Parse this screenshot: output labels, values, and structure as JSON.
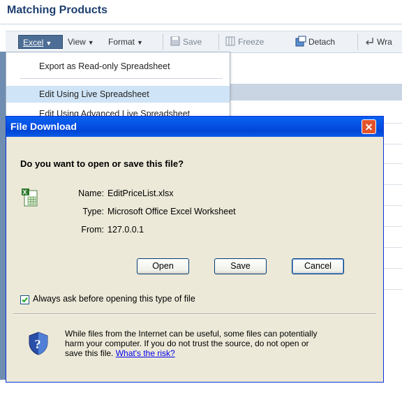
{
  "page": {
    "title": "Matching Products"
  },
  "toolbar": {
    "excel_label": "Excel",
    "view_label": "View",
    "format_label": "Format",
    "save_label": "Save",
    "freeze_label": "Freeze",
    "detach_label": "Detach",
    "wrap_label": "Wra"
  },
  "excel_menu": {
    "items": [
      {
        "label": "Export as Read-only Spreadsheet"
      },
      {
        "label": "Edit Using Live Spreadsheet"
      },
      {
        "label": "Edit Using Advanced Live Spreadsheet"
      }
    ]
  },
  "dialog": {
    "title": "File Download",
    "question": "Do you want to open or save this file?",
    "fields": [
      {
        "label": "Name:",
        "value": "EditPriceList.xlsx"
      },
      {
        "label": "Type:",
        "value": "Microsoft Office Excel Worksheet"
      },
      {
        "label": "From:",
        "value": "127.0.0.1"
      }
    ],
    "buttons": {
      "open": "Open",
      "save": "Save",
      "cancel": "Cancel"
    },
    "checkbox_label": "Always ask before opening this type of file",
    "checkbox_checked": true,
    "warning": {
      "line1": "While files from the Internet can be useful, some files can potentially",
      "line2": "harm your computer. If you do not trust the source, do not open or",
      "line3": "save this file.",
      "link": "What's the risk?"
    }
  },
  "colors": {
    "title_bar": "#0653e6",
    "dialog_bg": "#ece9d8",
    "menu_highlight": "#cfe4f6",
    "header_text": "#1d3f6e"
  }
}
